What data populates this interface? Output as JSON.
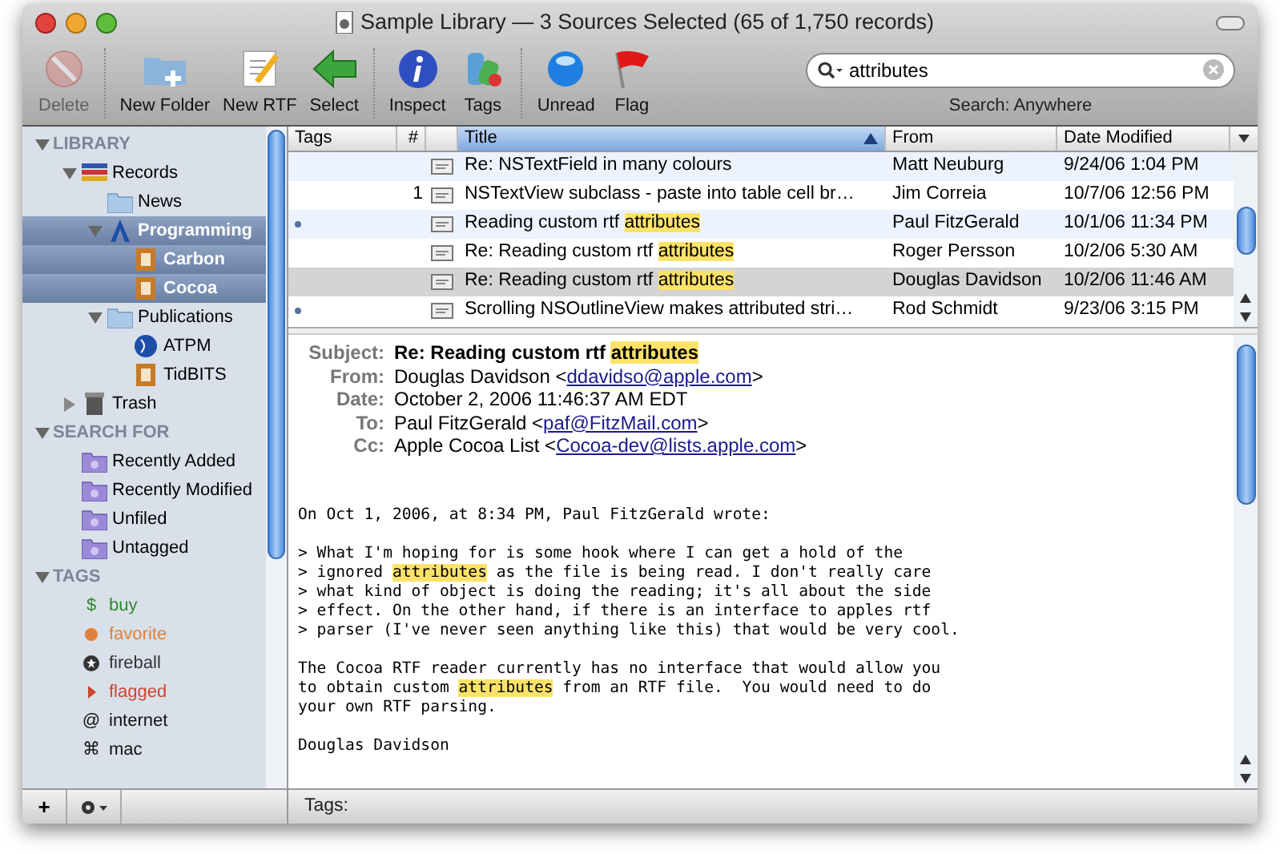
{
  "window": {
    "title": "Sample Library — 3 Sources Selected (65 of 1,750 records)"
  },
  "toolbar": [
    [
      {
        "label": "Delete",
        "kind": "delete",
        "disabled": true
      }
    ],
    [
      {
        "label": "New Folder",
        "kind": "new-folder",
        "disabled": false
      },
      {
        "label": "New RTF",
        "kind": "new-rtf",
        "disabled": false
      },
      {
        "label": "Select",
        "kind": "select",
        "disabled": false
      }
    ],
    [
      {
        "label": "Inspect",
        "kind": "inspect",
        "disabled": false
      },
      {
        "label": "Tags",
        "kind": "tags",
        "disabled": false
      }
    ],
    [
      {
        "label": "Unread",
        "kind": "unread",
        "disabled": false
      },
      {
        "label": "Flag",
        "kind": "flag",
        "disabled": false
      }
    ]
  ],
  "search": {
    "value": "attributes",
    "caption": "Search: Anywhere"
  },
  "sidebar": {
    "sections": [
      {
        "title": "LIBRARY",
        "items": [
          {
            "label": "Records",
            "kind": "records",
            "selected": false,
            "expanded": true,
            "children": [
              {
                "label": "News",
                "kind": "folder",
                "selected": false
              },
              {
                "label": "Programming",
                "kind": "programming",
                "selected": true,
                "expanded": true,
                "children": [
                  {
                    "label": "Carbon",
                    "kind": "doc",
                    "selected": true
                  },
                  {
                    "label": "Cocoa",
                    "kind": "doc",
                    "selected": true
                  }
                ]
              },
              {
                "label": "Publications",
                "kind": "folder",
                "selected": false,
                "expanded": true,
                "children": [
                  {
                    "label": "ATPM",
                    "kind": "globe",
                    "selected": false
                  },
                  {
                    "label": "TidBITS",
                    "kind": "doc",
                    "selected": false
                  }
                ]
              }
            ]
          },
          {
            "label": "Trash",
            "kind": "trash",
            "selected": false,
            "expanded": false
          }
        ]
      },
      {
        "title": "SEARCH FOR",
        "items": [
          {
            "label": "Recently Added",
            "kind": "smart",
            "selected": false
          },
          {
            "label": "Recently Modified",
            "kind": "smart",
            "selected": false
          },
          {
            "label": "Unfiled",
            "kind": "smart",
            "selected": false
          },
          {
            "label": "Untagged",
            "kind": "smart",
            "selected": false
          }
        ]
      },
      {
        "title": "TAGS",
        "tags": [
          {
            "label": "buy",
            "kind": "glyph",
            "symbol": "$",
            "color": "#2e8b2e"
          },
          {
            "label": "favorite",
            "kind": "favorite",
            "color": "#e0803a"
          },
          {
            "label": "fireball",
            "kind": "fireball",
            "color": "#333333"
          },
          {
            "label": "flagged",
            "kind": "flagged",
            "color": "#d0442c"
          },
          {
            "label": "internet",
            "kind": "glyph",
            "symbol": "@",
            "color": "#111111"
          },
          {
            "label": "mac",
            "kind": "glyph",
            "symbol": "⌘",
            "color": "#111111"
          }
        ]
      }
    ]
  },
  "table": {
    "columns": [
      {
        "label": "Tags",
        "selected": false
      },
      {
        "label": "#",
        "selected": false
      },
      {
        "label": "Title",
        "selected": true
      },
      {
        "label": "From",
        "selected": false
      },
      {
        "label": "Date Modified",
        "selected": false
      }
    ],
    "rows": [
      {
        "tagged": false,
        "number": "",
        "title": [
          {
            "text": "Re: NSTextField in many colours",
            "highlight": false
          }
        ],
        "from": "Matt Neuburg",
        "date": "9/24/06 1:04 PM",
        "selected": false
      },
      {
        "tagged": false,
        "number": "1",
        "title": [
          {
            "text": "NSTextView subclass - paste into table cell br…",
            "highlight": false
          }
        ],
        "from": "Jim Correia",
        "date": "10/7/06 12:56 PM",
        "selected": false
      },
      {
        "tagged": true,
        "number": "",
        "title": [
          {
            "text": "Reading custom rtf ",
            "highlight": false
          },
          {
            "text": "attributes",
            "highlight": true
          }
        ],
        "from": "Paul FitzGerald",
        "date": "10/1/06 11:34 PM",
        "selected": false
      },
      {
        "tagged": false,
        "number": "",
        "title": [
          {
            "text": "Re: Reading custom rtf ",
            "highlight": false
          },
          {
            "text": "attributes",
            "highlight": true
          }
        ],
        "from": "Roger Persson",
        "date": "10/2/06 5:30 AM",
        "selected": false
      },
      {
        "tagged": false,
        "number": "",
        "title": [
          {
            "text": "Re: Reading custom rtf ",
            "highlight": false
          },
          {
            "text": "attributes",
            "highlight": true
          }
        ],
        "from": "Douglas Davidson",
        "date": "10/2/06 11:46 AM",
        "selected": true
      },
      {
        "tagged": true,
        "number": "",
        "title": [
          {
            "text": "Scrolling NSOutlineView makes attributed stri…",
            "highlight": false
          }
        ],
        "from": "Rod Schmidt",
        "date": "9/23/06 3:15 PM",
        "selected": false
      }
    ]
  },
  "message": {
    "headers": [
      {
        "label": "Subject:",
        "value": [
          {
            "text": "Re: Reading custom rtf ",
            "highlight": false
          },
          {
            "text": "attributes",
            "highlight": true
          }
        ],
        "bold": true
      },
      {
        "label": "From:",
        "value": [
          {
            "text": "Douglas Davidson <",
            "highlight": false
          }
        ],
        "link": "ddavidso@apple.com",
        "after": ">",
        "bold": false
      },
      {
        "label": "Date:",
        "value": [
          {
            "text": "October 2, 2006 11:46:37 AM EDT",
            "highlight": false
          }
        ],
        "bold": false
      },
      {
        "label": "To:",
        "value": [
          {
            "text": "Paul FitzGerald <",
            "highlight": false
          }
        ],
        "link": "paf@FitzMail.com",
        "after": ">",
        "bold": false
      },
      {
        "label": "Cc:",
        "value": [
          {
            "text": "Apple Cocoa List <",
            "highlight": false
          }
        ],
        "link": "Cocoa-dev@lists.apple.com",
        "after": ">",
        "bold": false
      }
    ],
    "body": [
      [
        [
          {
            "text": "On Oct 1, 2006, at 8:34 PM, Paul FitzGerald wrote:",
            "highlight": false
          }
        ]
      ],
      [
        [
          {
            "text": "> What I'm hoping for is some hook where I can get a hold of the",
            "highlight": false
          }
        ],
        [
          {
            "text": "> ignored ",
            "highlight": false
          },
          {
            "text": "attributes",
            "highlight": true
          },
          {
            "text": " as the file is being read. I don't really care",
            "highlight": false
          }
        ],
        [
          {
            "text": "> what kind of object is doing the reading; it's all about the side",
            "highlight": false
          }
        ],
        [
          {
            "text": "> effect. On the other hand, if there is an interface to apples rtf",
            "highlight": false
          }
        ],
        [
          {
            "text": "> parser (I've never seen anything like this) that would be very cool.",
            "highlight": false
          }
        ]
      ],
      [
        [
          {
            "text": "The Cocoa RTF reader currently has no interface that would allow you",
            "highlight": false
          }
        ],
        [
          {
            "text": "to obtain custom ",
            "highlight": false
          },
          {
            "text": "attributes",
            "highlight": true
          },
          {
            "text": " from an RTF file.  You would need to do",
            "highlight": false
          }
        ],
        [
          {
            "text": "your own RTF parsing.",
            "highlight": false
          }
        ]
      ],
      [
        [
          {
            "text": "Douglas Davidson",
            "highlight": false
          }
        ]
      ]
    ],
    "tags_label": "Tags:"
  },
  "bottom_bar": {
    "add": "+"
  }
}
